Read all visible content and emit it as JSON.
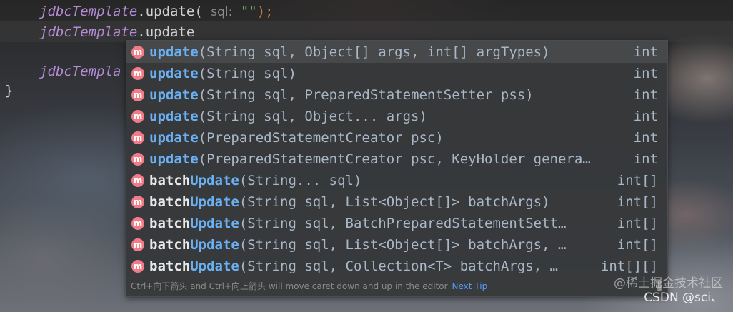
{
  "editor": {
    "line1": {
      "object": "jdbcTemplate",
      "method": ".update(",
      "hint": "sql:",
      "string": "\"\"",
      "close": ");"
    },
    "line2": {
      "object": "jdbcTemplate",
      "method": ".update"
    },
    "line3": {
      "object": "jdbcTempla"
    },
    "line4": {
      "brace": "}"
    }
  },
  "completion": {
    "icon_letter": "m",
    "items": [
      {
        "prefix": "",
        "match": "update",
        "params": "(String sql, Object[] args, int[] argTypes)",
        "returns": "int"
      },
      {
        "prefix": "",
        "match": "update",
        "params": "(String sql)",
        "returns": "int"
      },
      {
        "prefix": "",
        "match": "update",
        "params": "(String sql, PreparedStatementSetter pss)",
        "returns": "int"
      },
      {
        "prefix": "",
        "match": "update",
        "params": "(String sql, Object... args)",
        "returns": "int"
      },
      {
        "prefix": "",
        "match": "update",
        "params": "(PreparedStatementCreator psc)",
        "returns": "int"
      },
      {
        "prefix": "",
        "match": "update",
        "params": "(PreparedStatementCreator psc, KeyHolder genera…",
        "returns": "int"
      },
      {
        "prefix": "batch",
        "match": "Update",
        "params": "(String... sql)",
        "returns": "int[]"
      },
      {
        "prefix": "batch",
        "match": "Update",
        "params": "(String sql, List<Object[]> batchArgs)",
        "returns": "int[]"
      },
      {
        "prefix": "batch",
        "match": "Update",
        "params": "(String sql, BatchPreparedStatementSett…",
        "returns": "int[]"
      },
      {
        "prefix": "batch",
        "match": "Update",
        "params": "(String sql, List<Object[]> batchArgs, …",
        "returns": "int[]"
      },
      {
        "prefix": "batch",
        "match": "Update",
        "params": "(String sql, Collection<T> batchArgs, …",
        "returns": "int[][]"
      }
    ],
    "footer_text": "Ctrl+向下箭头 and Ctrl+向上箭头 will move caret down and up in the editor",
    "footer_link": "Next Tip"
  },
  "watermark": {
    "line1": "@稀土掘金技术社区",
    "line2": "CSDN @sci、"
  },
  "colors": {
    "method_icon": "#f17b87",
    "match": "#6ab0f3",
    "link": "#589df6"
  }
}
